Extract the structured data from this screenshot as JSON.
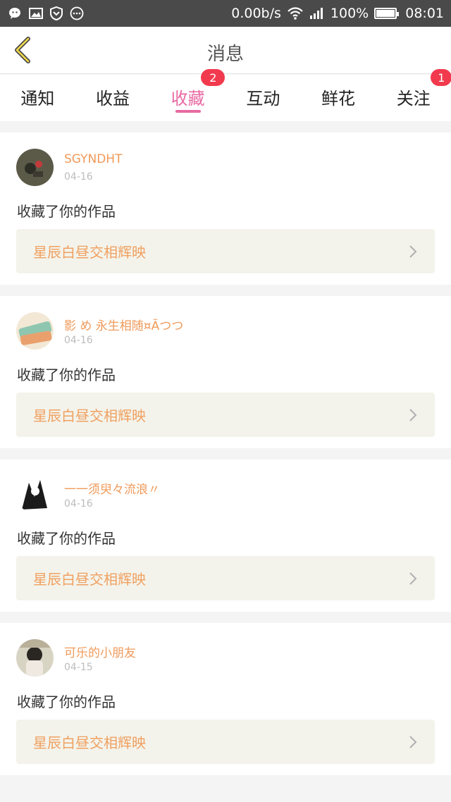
{
  "status_bar": {
    "network_speed": "0.00b/s",
    "battery": "100%",
    "time": "08:01"
  },
  "header": {
    "title": "消息"
  },
  "tabs": [
    {
      "label": "通知",
      "active": false,
      "badge": ""
    },
    {
      "label": "收益",
      "active": false,
      "badge": ""
    },
    {
      "label": "收藏",
      "active": true,
      "badge": "2"
    },
    {
      "label": "互动",
      "active": false,
      "badge": ""
    },
    {
      "label": "鲜花",
      "active": false,
      "badge": ""
    },
    {
      "label": "关注",
      "active": false,
      "badge": "1"
    }
  ],
  "notifications": [
    {
      "user": "SGYNDHT",
      "date": "04-16",
      "action": "收藏了你的作品",
      "work": "星辰白昼交相辉映"
    },
    {
      "user": "影 め 永生相随¤Ãつつ",
      "date": "04-16",
      "action": "收藏了你的作品",
      "work": "星辰白昼交相辉映"
    },
    {
      "user": "一一须臾々流浪〃",
      "date": "04-16",
      "action": "收藏了你的作品",
      "work": "星辰白昼交相辉映"
    },
    {
      "user": "可乐的小朋友",
      "date": "04-15",
      "action": "收藏了你的作品",
      "work": "星辰白昼交相辉映"
    }
  ],
  "colors": {
    "accent_pink": "#e86aa2",
    "username_orange": "#f09a5a",
    "badge_red": "#f23a4e"
  }
}
